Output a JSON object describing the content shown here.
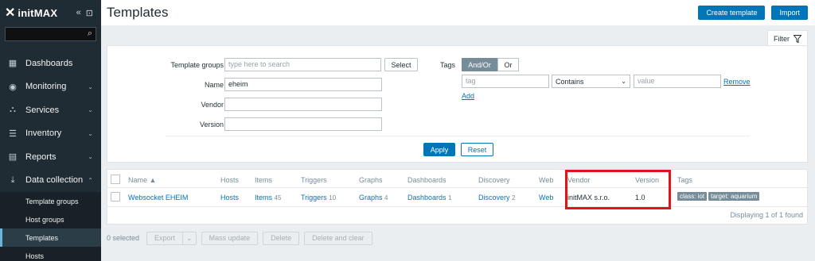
{
  "sidebar": {
    "brand": "initMAX",
    "collapse_glyph": "«",
    "expand_glyph": "⊡",
    "items": [
      {
        "label": "Dashboards",
        "icon": "▦",
        "chevron": ""
      },
      {
        "label": "Monitoring",
        "icon": "◉",
        "chevron": "⌄"
      },
      {
        "label": "Services",
        "icon": "⛬",
        "chevron": "⌄"
      },
      {
        "label": "Inventory",
        "icon": "☰",
        "chevron": "⌄"
      },
      {
        "label": "Reports",
        "icon": "▤",
        "chevron": "⌄"
      },
      {
        "label": "Data collection",
        "icon": "⤓",
        "chevron": "⌃"
      }
    ],
    "subitems": [
      {
        "label": "Template groups"
      },
      {
        "label": "Host groups"
      },
      {
        "label": "Templates"
      },
      {
        "label": "Hosts"
      }
    ]
  },
  "header": {
    "title": "Templates",
    "create_label": "Create template",
    "import_label": "Import"
  },
  "filter": {
    "tab_label": "Filter",
    "template_groups_label": "Template groups",
    "template_groups_placeholder": "type here to search",
    "select_label": "Select",
    "name_label": "Name",
    "name_value": "eheim",
    "vendor_label": "Vendor",
    "version_label": "Version",
    "tags_label": "Tags",
    "andor_label": "And/Or",
    "or_label": "Or",
    "tag_placeholder": "tag",
    "operator_value": "Contains",
    "value_placeholder": "value",
    "remove_label": "Remove",
    "add_label": "Add",
    "apply_label": "Apply",
    "reset_label": "Reset"
  },
  "table": {
    "headers": {
      "name": "Name ▲",
      "hosts": "Hosts",
      "items": "Items",
      "triggers": "Triggers",
      "graphs": "Graphs",
      "dashboards": "Dashboards",
      "discovery": "Discovery",
      "web": "Web",
      "vendor": "Vendor",
      "version": "Version",
      "tags": "Tags"
    },
    "rows": [
      {
        "name": "Websocket EHEIM",
        "hosts": "Hosts",
        "items": "Items",
        "items_count": "45",
        "triggers": "Triggers",
        "triggers_count": "10",
        "graphs": "Graphs",
        "graphs_count": "4",
        "dashboards": "Dashboards",
        "dashboards_count": "1",
        "discovery": "Discovery",
        "discovery_count": "2",
        "web": "Web",
        "vendor": "initMAX s.r.o.",
        "version": "1.0",
        "tag1": "class: iot",
        "tag2": "target: aquarium"
      }
    ],
    "displaying": "Displaying 1 of 1 found"
  },
  "actions": {
    "selected": "0 selected",
    "export": "Export",
    "export_caret": "⌄",
    "mass_update": "Mass update",
    "delete": "Delete",
    "delete_clear": "Delete and clear"
  },
  "colors": {
    "sidebar_bg": "#1f2c33",
    "accent_blue": "#0275b8",
    "highlight_red": "#e0151b"
  }
}
